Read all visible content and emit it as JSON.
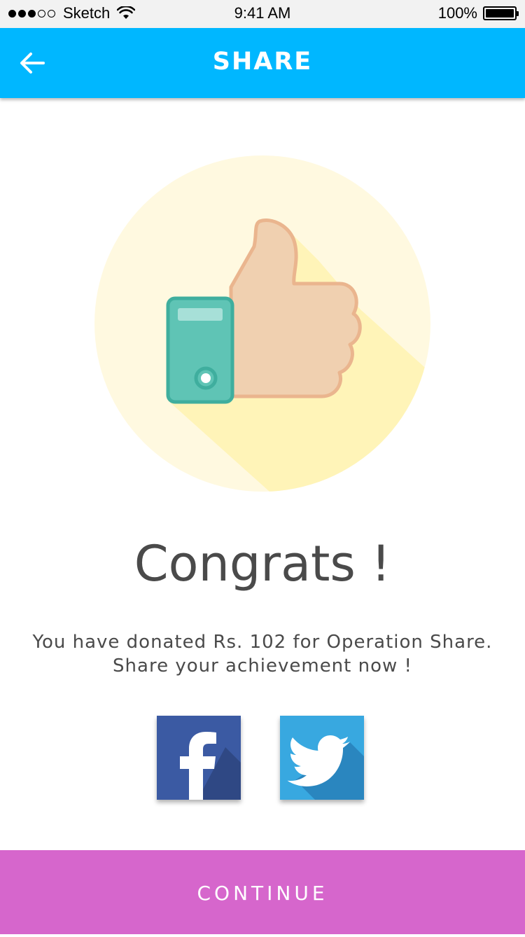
{
  "status_bar": {
    "carrier": "Sketch",
    "time": "9:41 AM",
    "battery": "100%"
  },
  "header": {
    "title": "SHARE",
    "back_icon": "arrow-left-icon"
  },
  "hero": {
    "icon": "thumbs-up-icon"
  },
  "main": {
    "heading": "Congrats !",
    "message_line1": "You have donated Rs. 102 for Operation Share.",
    "message_line2": "Share your achievement now !"
  },
  "social": {
    "facebook_icon": "facebook-icon",
    "twitter_icon": "twitter-icon"
  },
  "footer": {
    "continue_label": "CONTINUE"
  },
  "colors": {
    "header": "#00b7ff",
    "continue": "#d666cc",
    "facebook": "#3b5aa3",
    "twitter": "#38a8e0"
  }
}
